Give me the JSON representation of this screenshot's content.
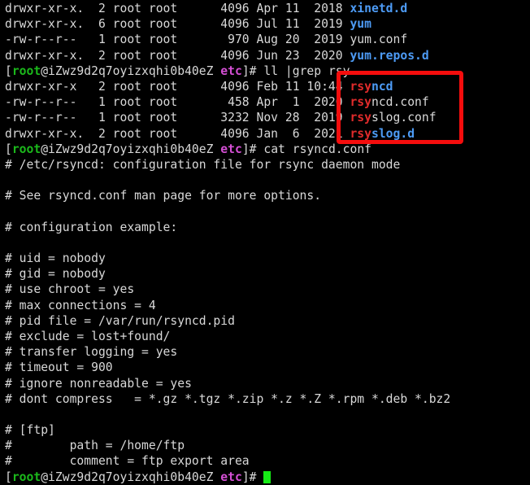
{
  "terminal": {
    "background_color": "#000000",
    "foreground_color": "#d8d8d8",
    "prompt": {
      "bracket_open": "[",
      "user": "root",
      "at": "@",
      "host": "iZwz9d2q7oyizxqhi0b40eZ",
      "space": " ",
      "cwd": "etc",
      "bracket_close": "]# ",
      "user_color": "#1bb81b",
      "cwd_color": "#d44fd4"
    },
    "colors": {
      "directory": "#4d9bf5",
      "file": "#d8d8d8",
      "grep_match": "#e02b2b",
      "cursor": "#16ea16",
      "annotation": "#f50d0d"
    },
    "listing_before": [
      {
        "perms": "drwxr-xr-x.",
        "links": "2",
        "owner": "root",
        "group": "root",
        "size": "4096",
        "month": "Apr",
        "day": "11",
        "time": "2018",
        "name": "xinetd.d",
        "type": "dir"
      },
      {
        "perms": "drwxr-xr-x.",
        "links": "6",
        "owner": "root",
        "group": "root",
        "size": "4096",
        "month": "Jul",
        "day": "11",
        "time": "2019",
        "name": "yum",
        "type": "dir"
      },
      {
        "perms": "-rw-r--r--",
        "links": "1",
        "owner": "root",
        "group": "root",
        "size": "970",
        "month": "Aug",
        "day": "20",
        "time": "2019",
        "name": "yum.conf",
        "type": "file"
      },
      {
        "perms": "drwxr-xr-x.",
        "links": "2",
        "owner": "root",
        "group": "root",
        "size": "4096",
        "month": "Jun",
        "day": "23",
        "time": "2020",
        "name": "yum.repos.d",
        "type": "dir"
      }
    ],
    "command_1": "ll |grep rsy",
    "grep_results": [
      {
        "perms": "drwxr-xr-x",
        "links": "2",
        "owner": "root",
        "group": "root",
        "size": "4096",
        "month": "Feb",
        "day": "11",
        "time": "10:44",
        "match": "rsy",
        "rest": "ncd",
        "type": "dir"
      },
      {
        "perms": "-rw-r--r--",
        "links": "1",
        "owner": "root",
        "group": "root",
        "size": "458",
        "month": "Apr",
        "day": "1",
        "time": "2020",
        "match": "rsy",
        "rest": "ncd.conf",
        "type": "file"
      },
      {
        "perms": "-rw-r--r--",
        "links": "1",
        "owner": "root",
        "group": "root",
        "size": "3232",
        "month": "Nov",
        "day": "28",
        "time": "2019",
        "match": "rsy",
        "rest": "slog.conf",
        "type": "file"
      },
      {
        "perms": "drwxr-xr-x.",
        "links": "2",
        "owner": "root",
        "group": "root",
        "size": "4096",
        "month": "Jan",
        "day": "6",
        "time": "2021",
        "match": "rsy",
        "rest": "slog.d",
        "type": "dir"
      }
    ],
    "command_2": "cat rsyncd.conf",
    "file_contents": [
      "# /etc/rsyncd: configuration file for rsync daemon mode",
      "",
      "# See rsyncd.conf man page for more options.",
      "",
      "# configuration example:",
      "",
      "# uid = nobody",
      "# gid = nobody",
      "# use chroot = yes",
      "# max connections = 4",
      "# pid file = /var/run/rsyncd.pid",
      "# exclude = lost+found/",
      "# transfer logging = yes",
      "# timeout = 900",
      "# ignore nonreadable = yes",
      "# dont compress   = *.gz *.tgz *.zip *.z *.Z *.rpm *.deb *.bz2",
      "",
      "# [ftp]",
      "#        path = /home/ftp",
      "#        comment = ftp export area"
    ]
  },
  "annotation": {
    "label": "red-highlight-box-around-grep-matches"
  }
}
